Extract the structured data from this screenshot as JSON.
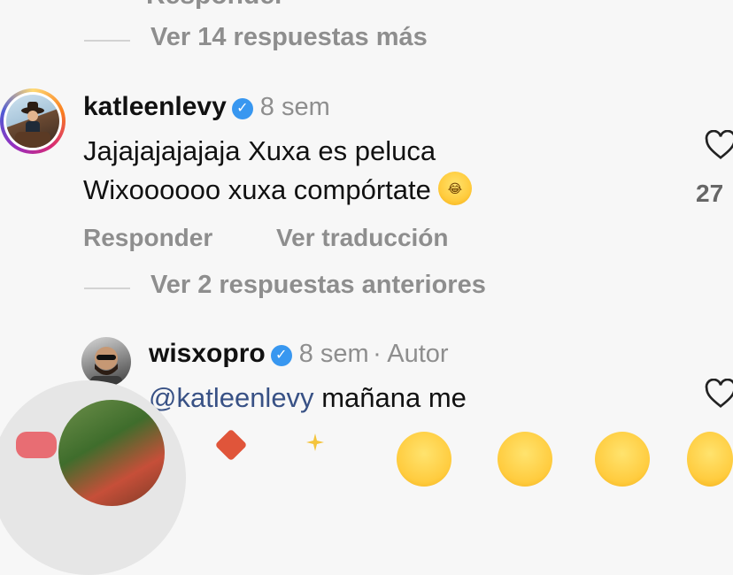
{
  "top_partial_text": "Responder",
  "top_replies": {
    "label": "Ver 14 respuestas más"
  },
  "comment1": {
    "username": "katleenlevy",
    "time": "8 sem",
    "line1": "Jajajajajajaja Xuxa es peluca",
    "line2": "Wixoooooo xuxa compórtate",
    "emoji": "laughing-tears",
    "reply_label": "Responder",
    "translate_label": "Ver traducción",
    "like_count": "27"
  },
  "earlier_replies": {
    "label": "Ver 2 respuestas anteriores"
  },
  "comment2": {
    "username": "wisxopro",
    "time": "8 sem",
    "author_label": "· Autor",
    "mention": "@katleenlevy",
    "text": "mañana me"
  },
  "colors": {
    "verified": "#3897f0",
    "mention": "#385185",
    "muted": "#8e8e8e"
  }
}
